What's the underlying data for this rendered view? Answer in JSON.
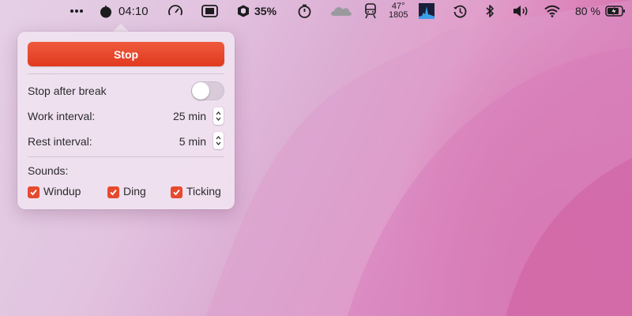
{
  "menubar": {
    "timer": "04:10",
    "battery_stat_percent": "35%",
    "weather_temp": "47°",
    "weather_time": "1805",
    "battery_percent": "80 %",
    "icons": [
      "more-icon",
      "tomato-icon",
      "speedometer-icon",
      "memory-icon",
      "package-icon",
      "timer-icon",
      "cloud-icon",
      "train-icon",
      "activity-graph-icon",
      "time-machine-icon",
      "bluetooth-icon",
      "volume-icon",
      "wifi-icon",
      "battery-charging-icon"
    ]
  },
  "popover": {
    "stop_label": "Stop",
    "stop_after_break_label": "Stop after break",
    "stop_after_break_on": false,
    "work_interval_label": "Work interval:",
    "work_interval_value": "25 min",
    "rest_interval_label": "Rest interval:",
    "rest_interval_value": "5 min",
    "sounds_label": "Sounds:",
    "sounds": [
      {
        "label": "Windup",
        "checked": true
      },
      {
        "label": "Ding",
        "checked": true
      },
      {
        "label": "Ticking",
        "checked": true
      }
    ]
  },
  "colors": {
    "accent": "#e64a2e",
    "stop_button": "#e8432a"
  }
}
